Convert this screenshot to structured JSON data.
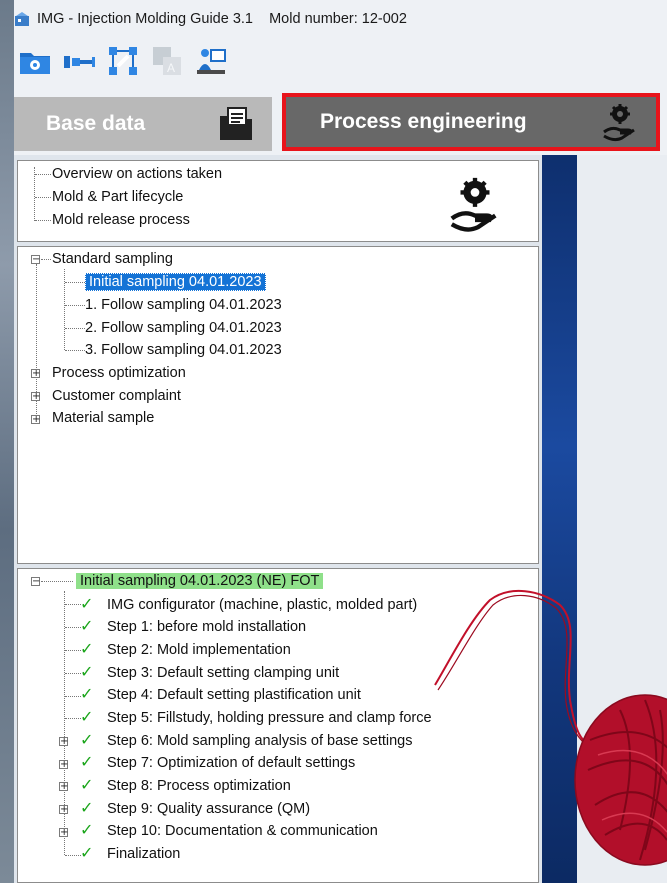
{
  "titlebar": {
    "title": "IMG - Injection Molding Guide 3.1    Mold number: 12-002",
    "icon": "app-icon"
  },
  "toolbar": {
    "buttons": [
      {
        "icon": "folder-gear-icon"
      },
      {
        "icon": "injection-unit-icon"
      },
      {
        "icon": "network-wrench-icon"
      },
      {
        "icon": "translate-icon"
      },
      {
        "icon": "training-icon"
      }
    ]
  },
  "tabs": {
    "base": {
      "label": "Base data",
      "icon": "folder-document-icon"
    },
    "process": {
      "label": "Process engineering",
      "icon": "gear-hand-icon",
      "highlight_color": "#e8141b"
    }
  },
  "panel1": {
    "items": [
      "Overview on actions taken",
      "Mold & Part lifecycle",
      "Mold release process"
    ]
  },
  "panel2": {
    "root": "Standard sampling",
    "children": [
      "Initial sampling 04.01.2023",
      "1.  Follow sampling 04.01.2023",
      "2.  Follow sampling 04.01.2023",
      "3.  Follow sampling 04.01.2023"
    ],
    "selected_index": 0,
    "other_roots": [
      "Process optimization",
      "Customer complaint",
      "Material sample"
    ]
  },
  "panel3": {
    "header": "Initial sampling  04.01.2023 (NE) FOT",
    "steps": [
      {
        "label": "IMG configurator (machine, plastic, molded part)",
        "expandable": false
      },
      {
        "label": "Step 1: before mold installation",
        "expandable": false
      },
      {
        "label": "Step 2: Mold implementation",
        "expandable": false
      },
      {
        "label": "Step 3: Default setting clamping unit",
        "expandable": false
      },
      {
        "label": "Step 4: Default setting plastification unit",
        "expandable": false
      },
      {
        "label": "Step 5: Fillstudy, holding pressure and clamp force",
        "expandable": false
      },
      {
        "label": "Step 6: Mold sampling analysis of base settings",
        "expandable": true
      },
      {
        "label": "Step 7: Optimization of default settings",
        "expandable": true
      },
      {
        "label": "Step 8: Process optimization",
        "expandable": true
      },
      {
        "label": "Step 9: Quality assurance (QM)",
        "expandable": true
      },
      {
        "label": "Step 10: Documentation & communication",
        "expandable": true
      },
      {
        "label": "Finalization",
        "expandable": false
      }
    ]
  },
  "colors": {
    "selection": "#1473d6",
    "header_green": "#8fe08a",
    "check": "#1aa51a"
  }
}
